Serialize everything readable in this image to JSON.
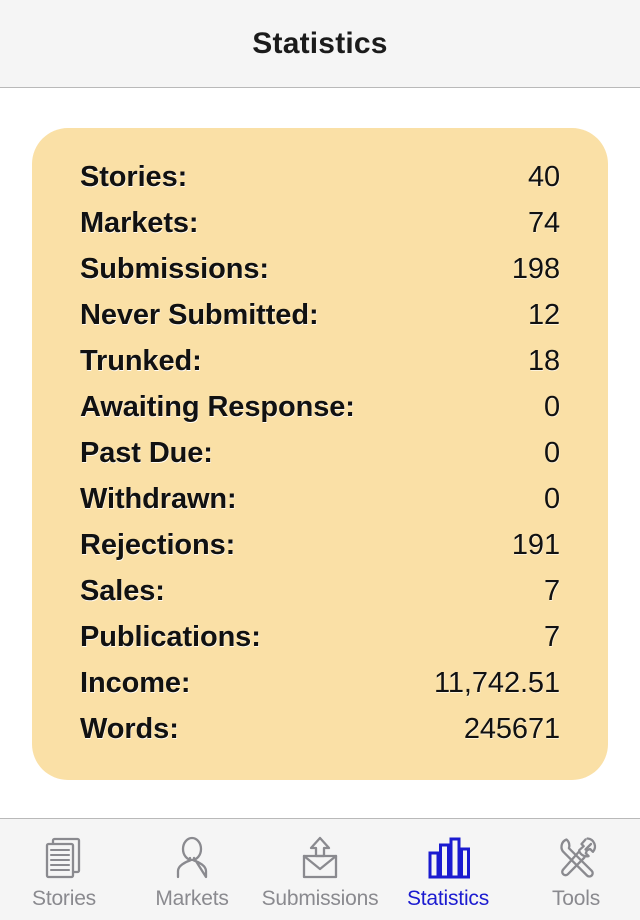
{
  "header": {
    "title": "Statistics"
  },
  "card": {
    "background_color": "#fae0a6",
    "rows": [
      {
        "label": "Stories:",
        "value": "40"
      },
      {
        "label": "Markets:",
        "value": "74"
      },
      {
        "label": "Submissions:",
        "value": "198"
      },
      {
        "label": "Never Submitted:",
        "value": "12"
      },
      {
        "label": "Trunked:",
        "value": "18"
      },
      {
        "label": "Awaiting Response:",
        "value": "0"
      },
      {
        "label": "Past Due:",
        "value": "0"
      },
      {
        "label": "Withdrawn:",
        "value": "0"
      },
      {
        "label": "Rejections:",
        "value": "191"
      },
      {
        "label": "Sales:",
        "value": "7"
      },
      {
        "label": "Publications:",
        "value": "7"
      },
      {
        "label": "Income:",
        "value": "11,742.51"
      },
      {
        "label": "Words:",
        "value": "245671"
      }
    ]
  },
  "tabbar": {
    "active_color": "#1b1bd0",
    "inactive_color": "#8a8a8f",
    "tabs": [
      {
        "label": "Stories",
        "icon": "documents-icon",
        "active": false
      },
      {
        "label": "Markets",
        "icon": "person-icon",
        "active": false
      },
      {
        "label": "Submissions",
        "icon": "envelope-up-icon",
        "active": false
      },
      {
        "label": "Statistics",
        "icon": "bar-chart-icon",
        "active": true
      },
      {
        "label": "Tools",
        "icon": "tools-icon",
        "active": false
      }
    ]
  }
}
